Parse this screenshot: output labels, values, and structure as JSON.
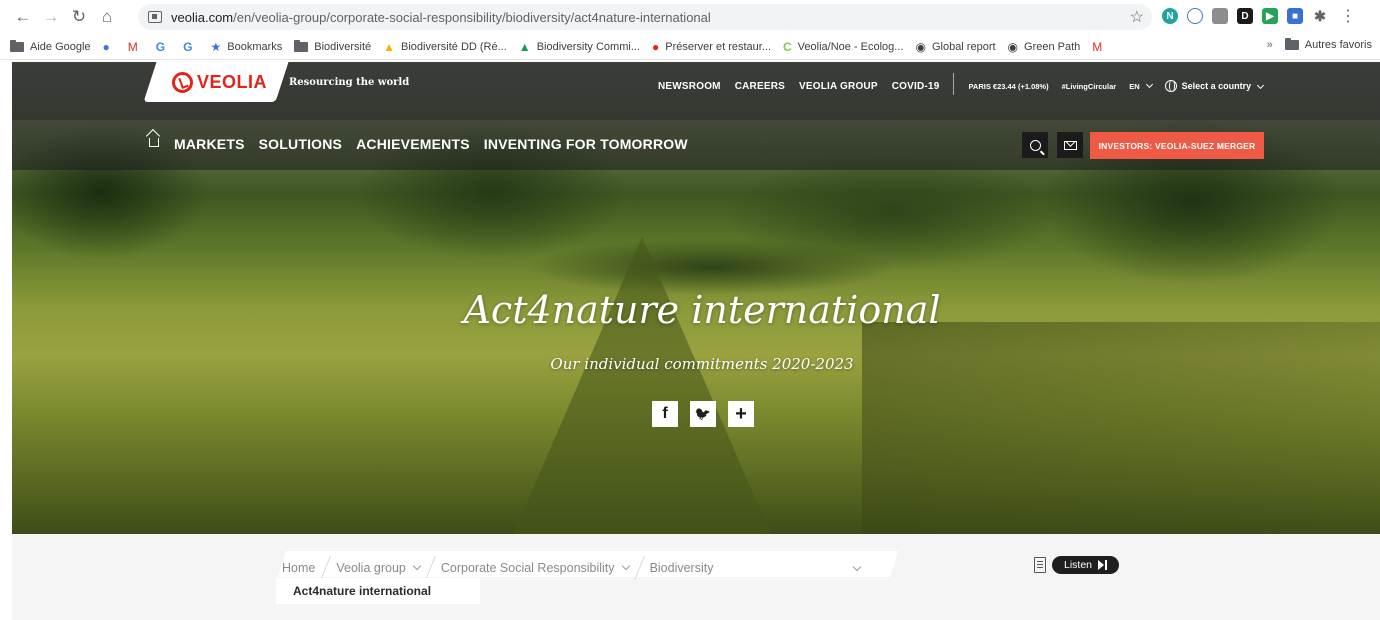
{
  "browser": {
    "url_host": "veolia.com",
    "url_path": "/en/veolia-group/corporate-social-responsibility/biodiversity/act4nature-international",
    "bookmarks": [
      {
        "label": "Aide Google"
      },
      {
        "label": "Bookmarks"
      },
      {
        "label": "Biodiversité"
      },
      {
        "label": "Biodiversité DD (Ré..."
      },
      {
        "label": "Biodiversity Commi..."
      },
      {
        "label": "Préserver et restaur..."
      },
      {
        "label": "Veolia/Noe - Ecolog..."
      },
      {
        "label": "Global report"
      },
      {
        "label": "Green Path"
      }
    ],
    "more_label": "»",
    "other_bookmarks": "Autres favoris"
  },
  "header": {
    "brand": "VEOLIA",
    "tagline": "Resourcing the world",
    "util_nav": [
      "NEWSROOM",
      "CAREERS",
      "VEOLIA GROUP",
      "COVID-19"
    ],
    "stock": "PARIS €23.44 (+1.08%)",
    "hashtag": "#LivingCircular",
    "language": "EN",
    "country_select": "Select a country"
  },
  "main_nav": {
    "items": [
      "MARKETS",
      "SOLUTIONS",
      "ACHIEVEMENTS",
      "INVENTING FOR TOMORROW"
    ],
    "investors_label": "INVESTORS: VEOLIA-SUEZ MERGER"
  },
  "hero": {
    "title": "Act4nature international",
    "subtitle": "Our individual commitments 2020-2023",
    "share_buttons": [
      "f",
      "🐦",
      "+"
    ]
  },
  "breadcrumb": {
    "items": [
      "Home",
      "Veolia group",
      "Corporate Social Responsibility",
      "Biodiversity"
    ],
    "current": "Act4nature international",
    "listen_label": "Listen"
  }
}
